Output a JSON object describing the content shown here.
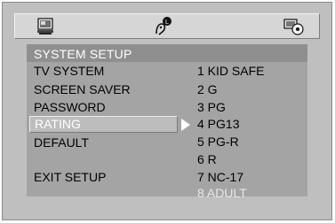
{
  "top_icons": [
    "tv-monitor-icon",
    "language-person-icon",
    "speaker-disc-icon"
  ],
  "header": {
    "title": "SYSTEM SETUP"
  },
  "menu": {
    "items": [
      {
        "label": "TV SYSTEM"
      },
      {
        "label": "SCREEN SAVER"
      },
      {
        "label": "PASSWORD"
      },
      {
        "label": "RATING",
        "selected": true
      },
      {
        "label": "DEFAULT"
      },
      {
        "label": "EXIT SETUP"
      }
    ]
  },
  "rating_options": [
    {
      "label": "1 KID SAFE"
    },
    {
      "label": "2 G"
    },
    {
      "label": "3 PG"
    },
    {
      "label": "4 PG13"
    },
    {
      "label": "5 PG-R"
    },
    {
      "label": "6 R"
    },
    {
      "label": "7 NC-17"
    },
    {
      "label": "8 ADULT",
      "current": true
    }
  ],
  "colors": {
    "frame_bg": "#bfbfbf",
    "panel_bg": "#a4a4a4",
    "header_bg": "#8f8f8f",
    "highlight_text": "#ffffff"
  }
}
